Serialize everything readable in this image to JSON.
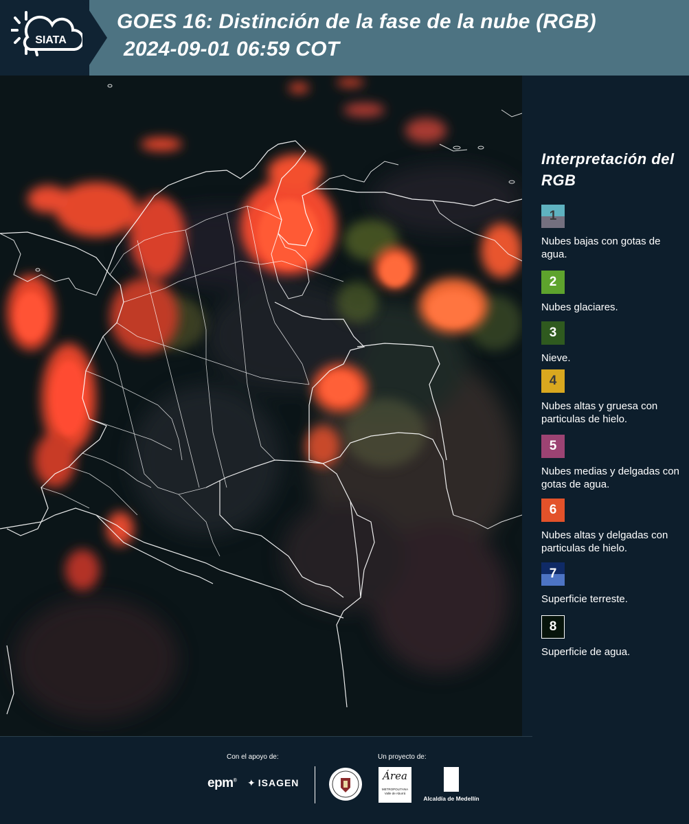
{
  "header": {
    "logo_text": "SIATA",
    "title_line1": "GOES 16: Distinción de la fase de la nube (RGB)",
    "title_line2": "2024-09-01 06:59 COT",
    "background_color": "#4d7382"
  },
  "legend": {
    "title": "Interpretación del RGB",
    "items": [
      {
        "number": "1",
        "label": "Nubes bajas con gotas de agua.",
        "colors": [
          "#5fb2c0",
          "#74707f"
        ],
        "number_color": "#3a3a3a"
      },
      {
        "number": "2",
        "label": "Nubes glaciares.",
        "colors": [
          "#5ea32d"
        ],
        "number_color": "#ffffff"
      },
      {
        "number": "3",
        "label": "Nieve.",
        "colors": [
          "#2f5a1f"
        ],
        "number_color": "#ffffff"
      },
      {
        "number": "4",
        "label": "Nubes altas y gruesa con particulas de hielo.",
        "colors": [
          "#d9a81f"
        ],
        "number_color": "#3a3a3a"
      },
      {
        "number": "5",
        "label": "Nubes medias y delgadas con gotas de agua.",
        "colors": [
          "#9c4373"
        ],
        "number_color": "#ffffff"
      },
      {
        "number": "6",
        "label": "Nubes altas y delgadas con particulas de hielo.",
        "colors": [
          "#e3522a"
        ],
        "number_color": "#ffffff"
      },
      {
        "number": "7",
        "label": "Superficie terreste.",
        "colors": [
          "#0f2a66",
          "#4d74c4"
        ],
        "number_color": "#ffffff"
      },
      {
        "number": "8",
        "label": "Superficie de agua.",
        "colors": [
          "#07140b"
        ],
        "number_color": "#ffffff"
      }
    ]
  },
  "footer": {
    "support_label": "Con el apoyo de:",
    "project_label": "Un proyecto de:",
    "epm_logo": "epm",
    "isagen_logo": "ISAGEN",
    "area_logo_script": "Área",
    "area_logo_sub": "METROPOLITANA Valle de Aburrá",
    "medellin_logo": "Alcaldía de Medellín"
  }
}
